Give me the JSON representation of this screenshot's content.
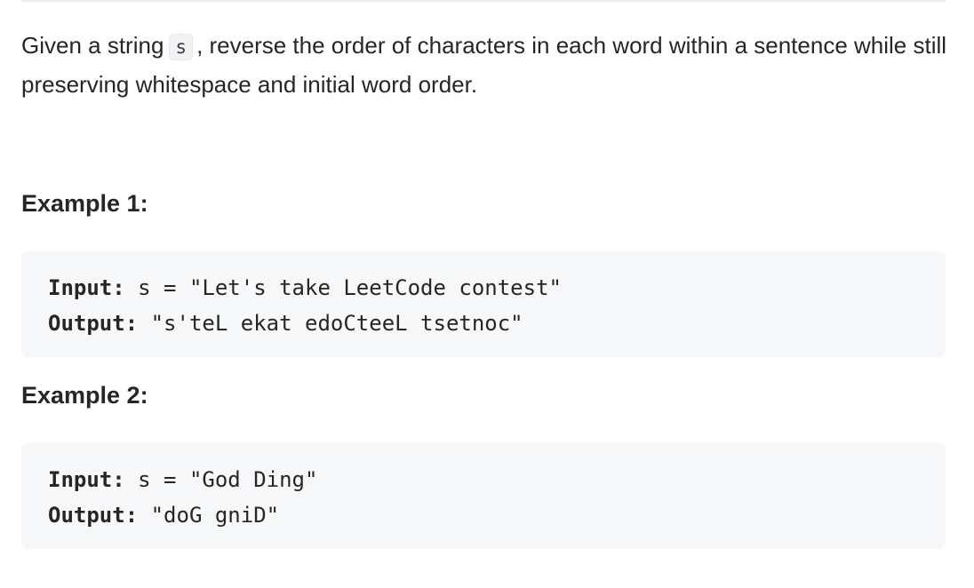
{
  "description": {
    "before_code": "Given a string",
    "code": "s",
    "after_code": ", reverse the order of characters in each word within a sentence while still preserving whitespace and initial word order."
  },
  "examples": [
    {
      "heading": "Example 1:",
      "input_label": "Input:",
      "input_value": " s = \"Let's take LeetCode contest\"",
      "output_label": "Output:",
      "output_value": " \"s'teL ekat edoCteeL tsetnoc\""
    },
    {
      "heading": "Example 2:",
      "input_label": "Input:",
      "input_value": " s = \"God Ding\"",
      "output_label": "Output:",
      "output_value": " \"doG gniD\""
    }
  ]
}
